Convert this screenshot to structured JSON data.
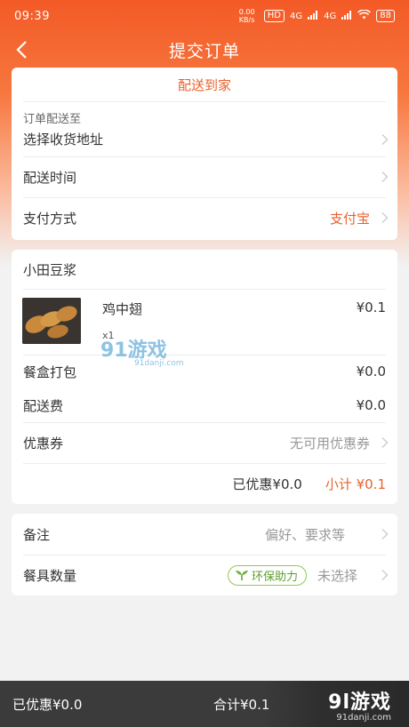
{
  "status": {
    "time": "09:39",
    "net_speed": "0.00 KB/s",
    "hd": "HD",
    "signal1": "4G",
    "signal2": "4G",
    "battery": "88"
  },
  "nav": {
    "title": "提交订单"
  },
  "delivery": {
    "mode_tab": "配送到家",
    "address_caption": "订单配送至",
    "address_label": "选择收货地址",
    "time_label": "配送时间",
    "payment_label": "支付方式",
    "payment_value": "支付宝"
  },
  "order": {
    "shop_name": "小田豆浆",
    "items": [
      {
        "name": "鸡中翅",
        "qty": "x1",
        "price": "¥0.1"
      }
    ],
    "packing_label": "餐盒打包",
    "packing_value": "¥0.0",
    "delivery_fee_label": "配送费",
    "delivery_fee_value": "¥0.0",
    "coupon_label": "优惠券",
    "coupon_value": "无可用优惠券",
    "discount_text": "已优惠¥0.0",
    "subtotal_text": "小计 ¥0.1"
  },
  "extras": {
    "remark_label": "备注",
    "remark_placeholder": "偏好、要求等",
    "utensils_label": "餐具数量",
    "eco_badge": "环保助力",
    "utensils_value": "未选择"
  },
  "footer": {
    "discount": "已优惠¥0.0",
    "total": "合计¥0.1"
  },
  "watermark": {
    "main": "91游戏",
    "sub": "91danji.com"
  },
  "brand_logo": {
    "main": "9l游戏",
    "sub": "91danji.com"
  },
  "colors": {
    "accent": "#e8622c",
    "header": "#f35a26",
    "eco": "#5e9f2e",
    "footer_bg": "#3b3b3b"
  }
}
